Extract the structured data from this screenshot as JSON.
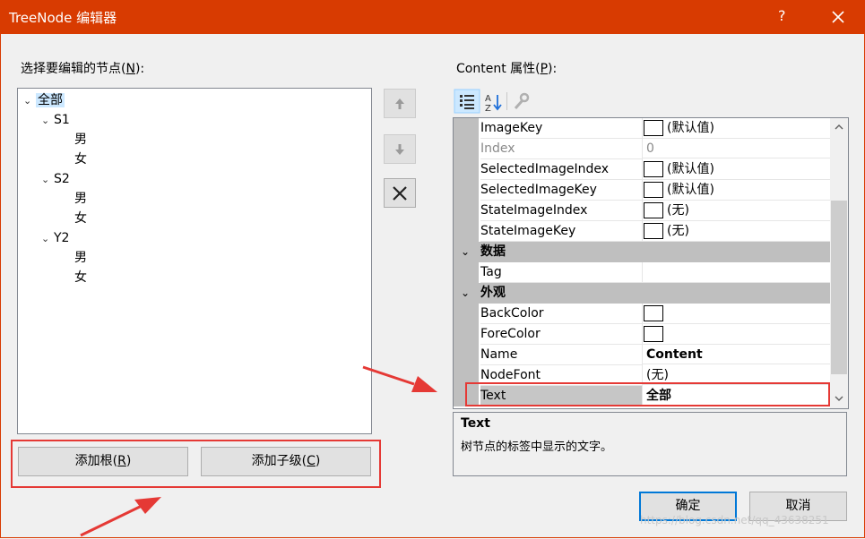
{
  "window": {
    "title": "TreeNode 编辑器",
    "help": "?",
    "accent": "#d83b01"
  },
  "left": {
    "label_prefix": "选择要编辑的节点(",
    "label_key": "N",
    "label_suffix": "):",
    "tree": [
      {
        "text": "全部",
        "expanded": true,
        "selected": true
      },
      {
        "text": "S1",
        "expanded": true
      },
      {
        "text": "男"
      },
      {
        "text": "女"
      },
      {
        "text": "S2",
        "expanded": true
      },
      {
        "text": "男"
      },
      {
        "text": "女"
      },
      {
        "text": "Y2",
        "expanded": true
      },
      {
        "text": "男"
      },
      {
        "text": "女"
      }
    ],
    "add_root": {
      "prefix": "添加根(",
      "key": "R",
      "suffix": ")"
    },
    "add_child": {
      "prefix": "添加子级(",
      "key": "C",
      "suffix": ")"
    }
  },
  "side_buttons": {
    "up_icon": "arrow-up-icon",
    "down_icon": "arrow-down-icon",
    "delete_icon": "delete-x-icon"
  },
  "right": {
    "label_prefix": "Content 属性(",
    "label_key": "P",
    "label_suffix": "):",
    "toolbar": [
      "categorized-icon",
      "alphabetical-icon",
      "property-pages-icon"
    ],
    "rows": [
      {
        "name": "ImageKey",
        "value": "(默认值)",
        "swatch": true
      },
      {
        "name": "Index",
        "value": "0",
        "disabled": true
      },
      {
        "name": "SelectedImageIndex",
        "value": "(默认值)",
        "swatch": true
      },
      {
        "name": "SelectedImageKey",
        "value": "(默认值)",
        "swatch": true
      },
      {
        "name": "StateImageIndex",
        "value": "(无)",
        "swatch": true
      },
      {
        "name": "StateImageKey",
        "value": "(无)",
        "swatch": true
      },
      {
        "category": "数据"
      },
      {
        "name": "Tag",
        "value": ""
      },
      {
        "category": "外观"
      },
      {
        "name": "BackColor",
        "value": "",
        "swatch": true
      },
      {
        "name": "ForeColor",
        "value": "",
        "swatch": true
      },
      {
        "name": "Name",
        "value": "Content",
        "bold": true
      },
      {
        "name": "NodeFont",
        "value": "(无)"
      },
      {
        "name": "Text",
        "value": "全部",
        "bold": true,
        "selected": true
      }
    ],
    "description": {
      "title": "Text",
      "text": "树节点的标签中显示的文字。"
    }
  },
  "footer": {
    "ok": "确定",
    "cancel": "取消",
    "watermark": "https://blog.csdn.net/qq_43638251"
  },
  "annotation_color": "#e53935"
}
